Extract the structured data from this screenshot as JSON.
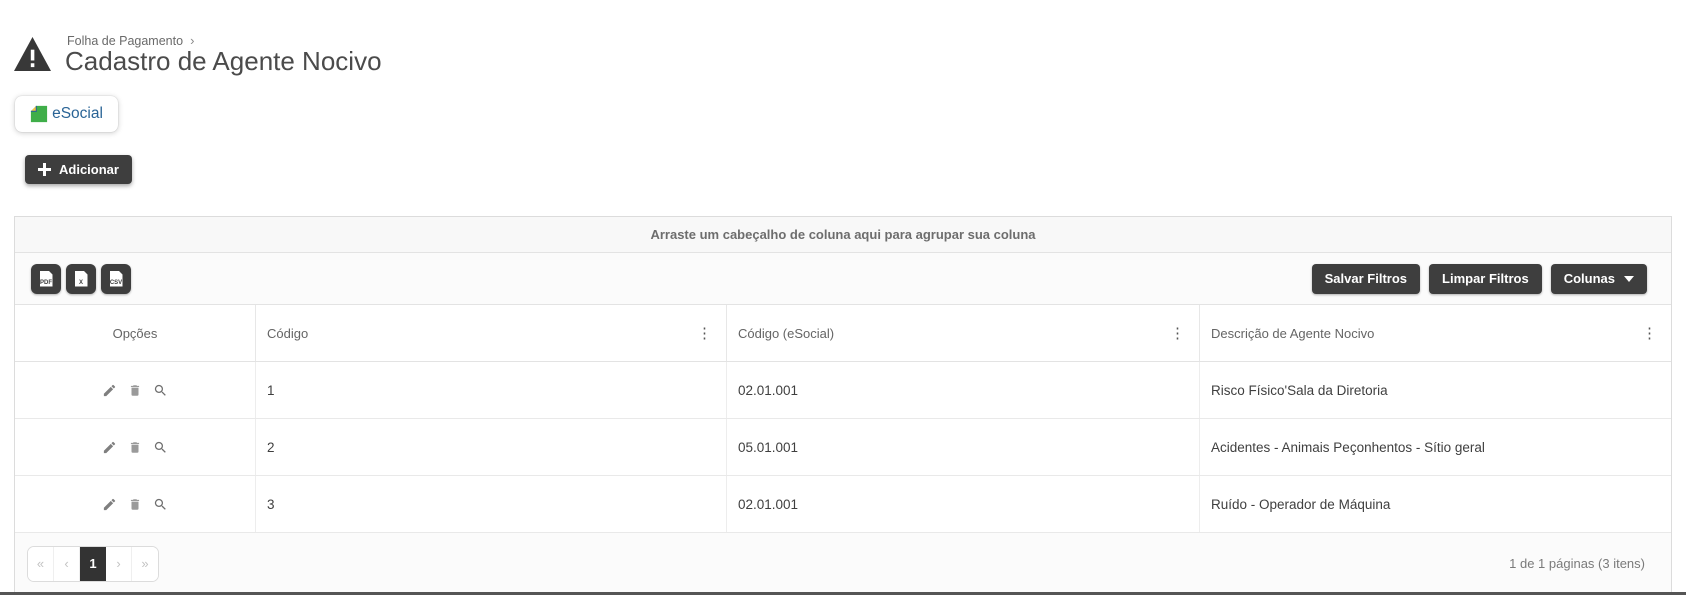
{
  "colors": {
    "accent_dark": "#3e3e3e",
    "esocial_blue": "#2a6496",
    "esocial_green": "#3fae49",
    "icon_gray": "#7f7f7f",
    "border": "#e0e0e0"
  },
  "icons": {
    "header": "warning-triangle",
    "add": "plus",
    "row_actions": [
      "pencil",
      "trash",
      "magnifier"
    ],
    "column_menu_glyph": "⋮"
  },
  "header": {
    "breadcrumb": "Folha de Pagamento",
    "breadcrumb_chevron": "›",
    "title": "Cadastro de Agente Nocivo",
    "esocial_label": "eSocial",
    "add_label": "Adicionar"
  },
  "grid": {
    "group_hint": "Arraste um cabeçalho de coluna aqui para agrupar sua coluna",
    "export": [
      {
        "name": "pdf",
        "label": "PDF"
      },
      {
        "name": "excel",
        "label": "X"
      },
      {
        "name": "csv",
        "label": "CSV"
      }
    ],
    "filters": {
      "save": "Salvar Filtros",
      "clear": "Limpar Filtros",
      "columns": "Colunas"
    },
    "columns": {
      "options": "Opções",
      "code": "Código",
      "code_esocial": "Código (eSocial)",
      "description": "Descrição de Agente Nocivo",
      "menu_glyph": "⋮"
    },
    "rows": [
      {
        "code": "1",
        "code_esocial": "02.01.001",
        "description": "Risco Físico'Sala da Diretoria"
      },
      {
        "code": "2",
        "code_esocial": "05.01.001",
        "description": "Acidentes - Animais Peçonhentos - Sítio geral"
      },
      {
        "code": "3",
        "code_esocial": "02.01.001",
        "description": "Ruído - Operador de Máquina"
      }
    ],
    "pager": {
      "first": "«",
      "prev": "‹",
      "page": "1",
      "next": "›",
      "last": "»",
      "summary": "1 de 1 páginas (3 itens)"
    }
  }
}
